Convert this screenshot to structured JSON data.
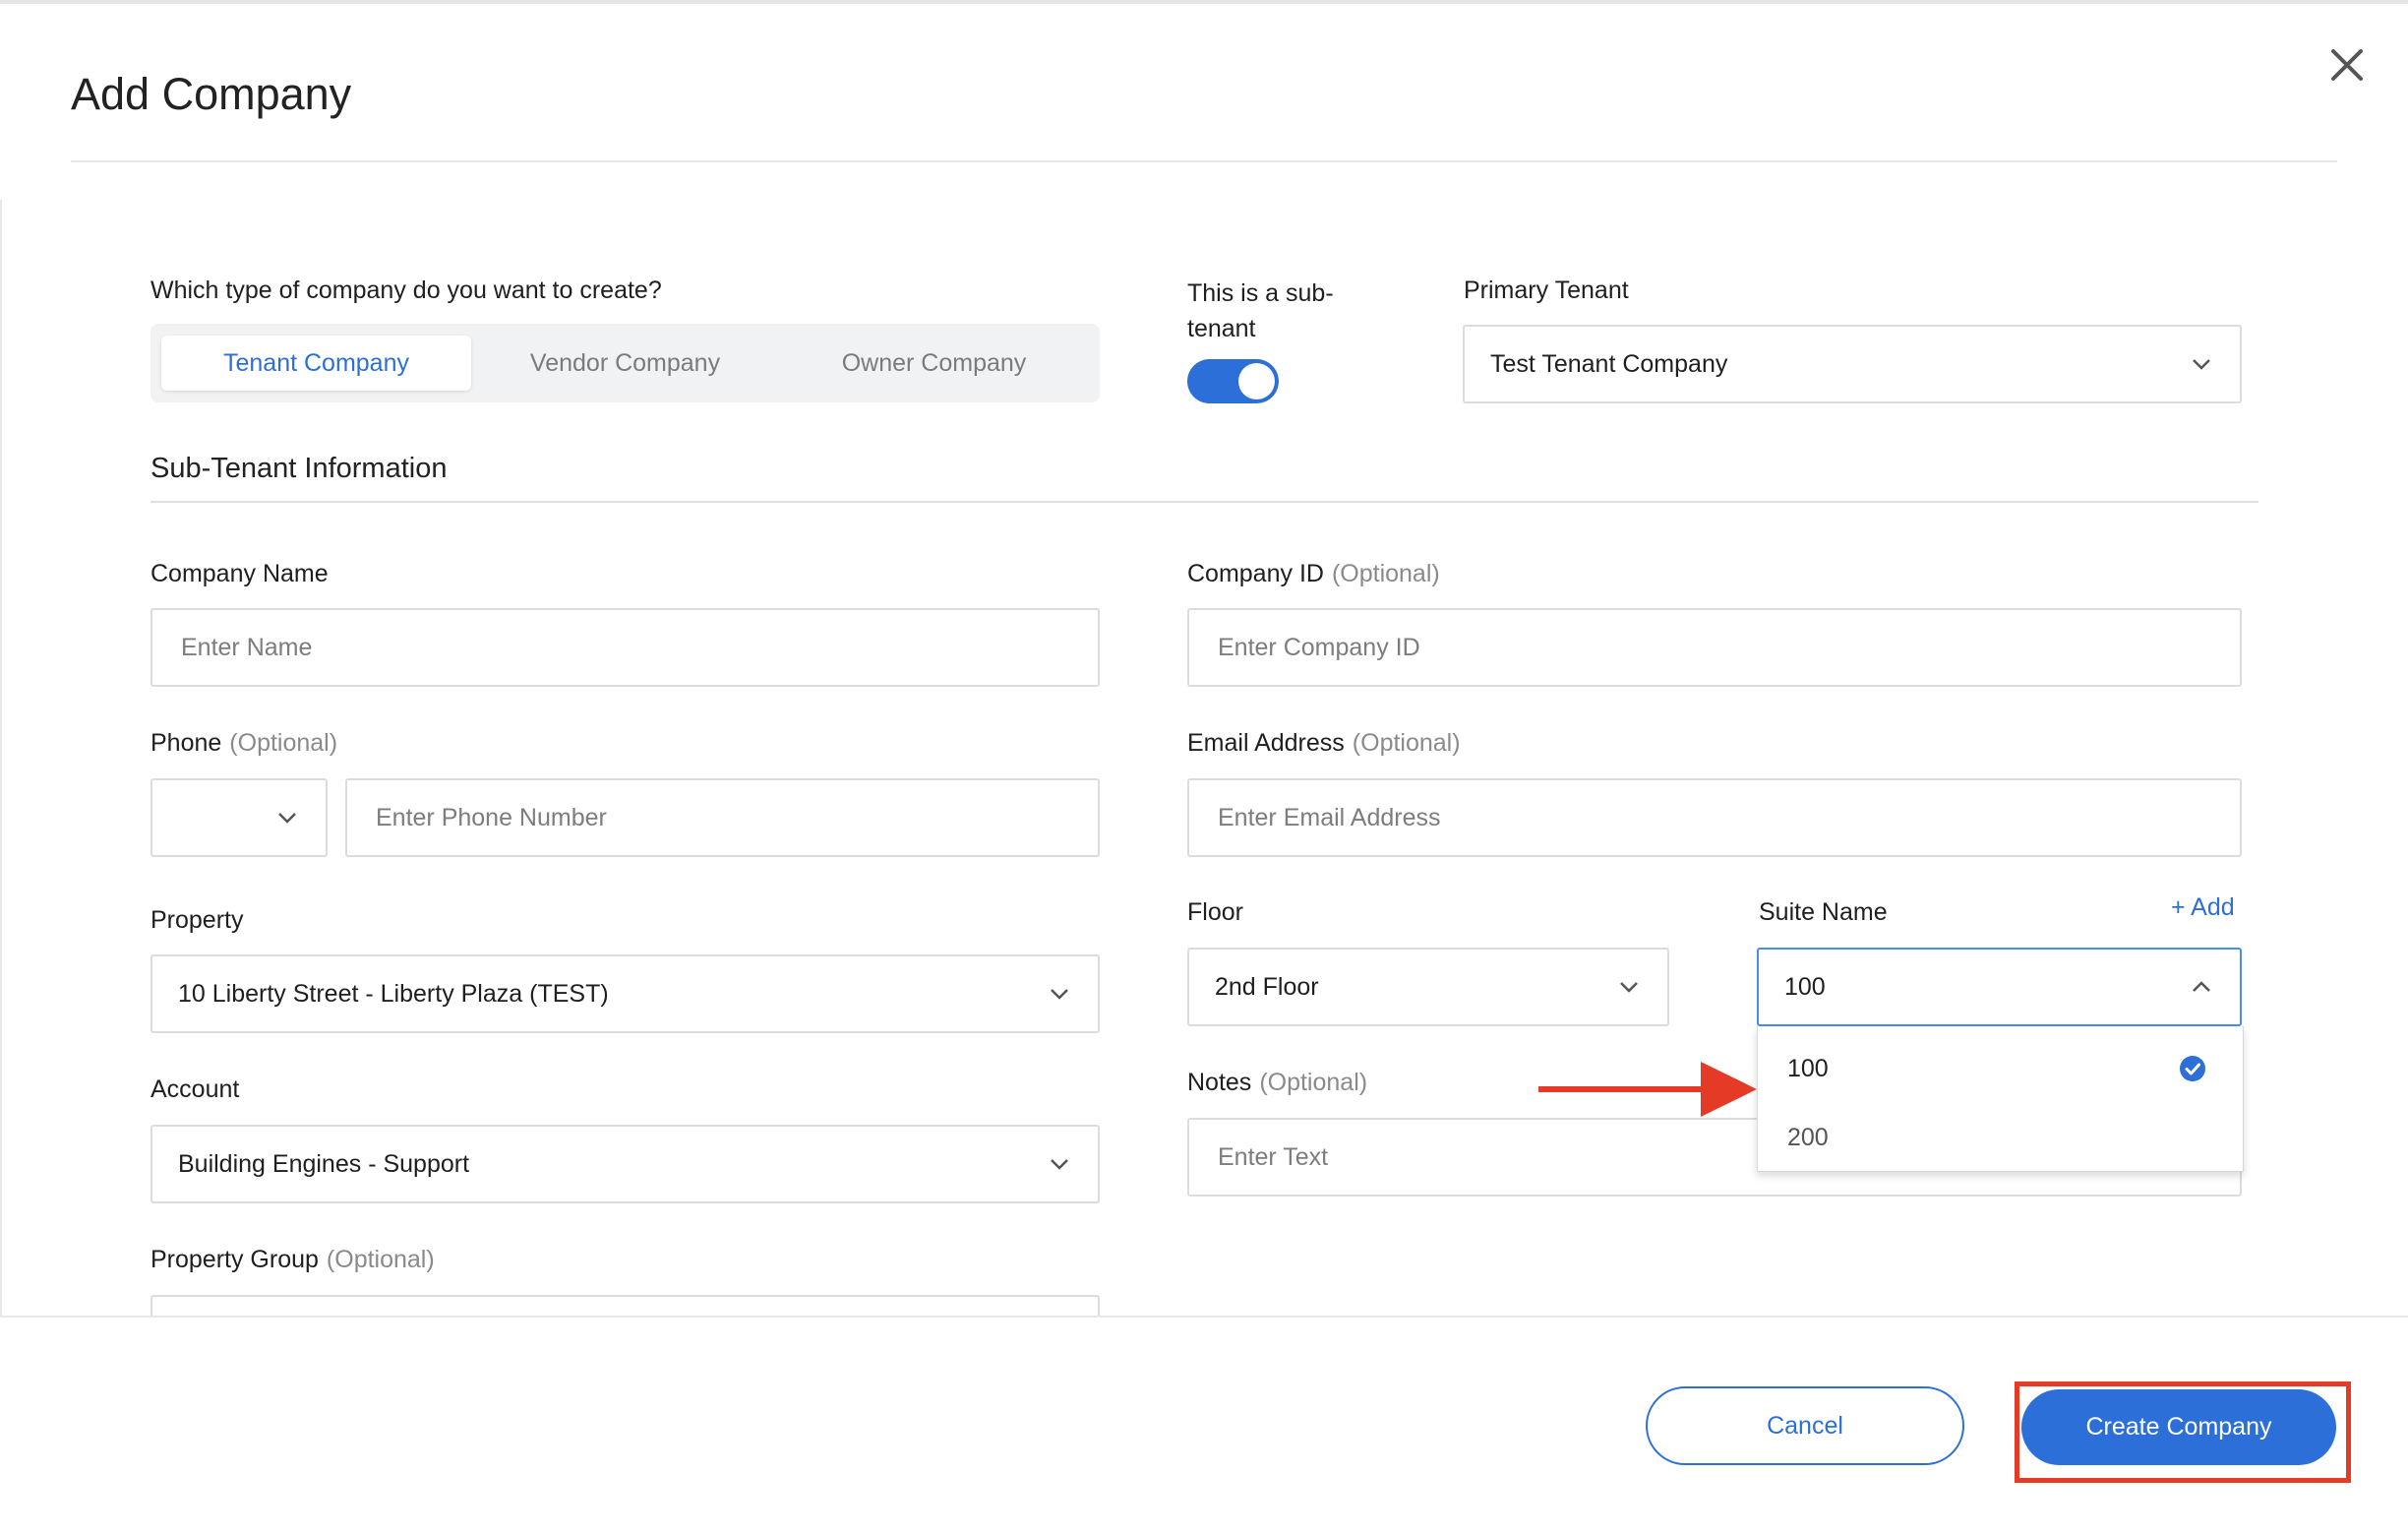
{
  "modal": {
    "title": "Add Company"
  },
  "company_type": {
    "question": "Which type of company do you want to create?",
    "options": [
      "Tenant Company",
      "Vendor Company",
      "Owner Company"
    ],
    "selected": "Tenant Company"
  },
  "sub_tenant_toggle": {
    "label": "This is a sub-tenant",
    "on": true
  },
  "primary_tenant": {
    "label": "Primary Tenant",
    "value": "Test Tenant Company"
  },
  "section": {
    "title": "Sub-Tenant Information"
  },
  "optional_text": "(Optional)",
  "fields": {
    "company_name": {
      "label": "Company Name",
      "placeholder": "Enter Name"
    },
    "company_id": {
      "label": "Company ID",
      "placeholder": "Enter Company ID"
    },
    "phone": {
      "label": "Phone",
      "country_code": "",
      "placeholder": "Enter Phone Number"
    },
    "email": {
      "label": "Email Address",
      "placeholder": "Enter Email Address"
    },
    "property": {
      "label": "Property",
      "value": "10 Liberty Street - Liberty Plaza (TEST)"
    },
    "floor": {
      "label": "Floor",
      "value": "2nd Floor"
    },
    "suite_name": {
      "label": "Suite Name",
      "add_label": "+ Add",
      "value": "100",
      "options": [
        "100",
        "200"
      ],
      "selected": "100"
    },
    "account": {
      "label": "Account",
      "value": "Building Engines - Support"
    },
    "notes": {
      "label": "Notes",
      "placeholder": "Enter Text"
    },
    "property_group": {
      "label": "Property Group"
    }
  },
  "footer": {
    "cancel_label": "Cancel",
    "create_label": "Create Company"
  },
  "colors": {
    "accent": "#2d6fd8",
    "annotation": "#e53a25"
  },
  "icons": {
    "close": "close-icon",
    "chevron_down": "chevron-down-icon",
    "chevron_up": "chevron-up-icon",
    "check": "check-circle-icon"
  }
}
